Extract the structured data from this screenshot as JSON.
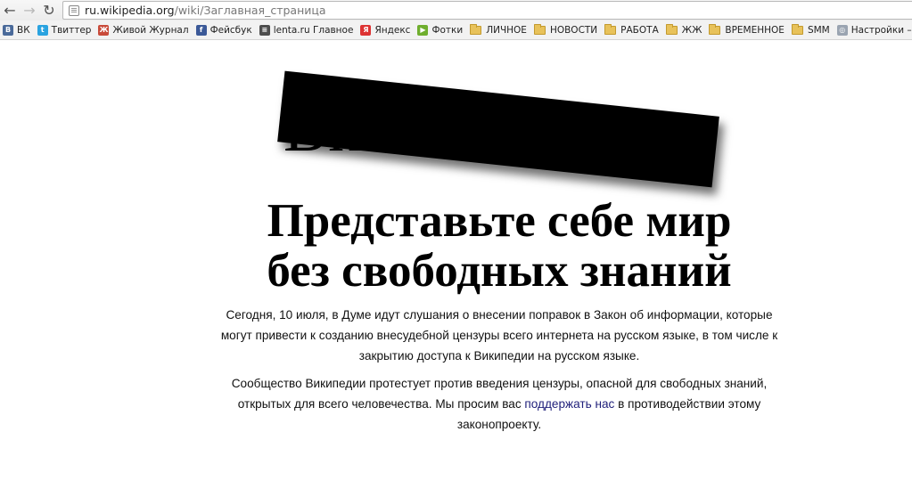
{
  "browser": {
    "nav": {
      "back_glyph": "←",
      "forward_glyph": "→",
      "reload_glyph": "↻"
    },
    "address_bar": {
      "host": "ru.wikipedia.org",
      "path": "/wiki/Заглавная_страница"
    },
    "bookmarks": [
      {
        "label": "ВК",
        "icon": "vk-icon",
        "color": "#4a6a9a",
        "glyph": "В"
      },
      {
        "label": "Твиттер",
        "icon": "twitter-icon",
        "color": "#2aa3e0",
        "glyph": "t"
      },
      {
        "label": "Живой Журнал",
        "icon": "livejournal-icon",
        "color": "#c94b3a",
        "glyph": "Ж"
      },
      {
        "label": "Фейсбук",
        "icon": "facebook-icon",
        "color": "#3b5998",
        "glyph": "f"
      },
      {
        "label": "lenta.ru Главное",
        "icon": "lenta-icon",
        "color": "#4d4d4d",
        "glyph": "≡"
      },
      {
        "label": "Яндекс",
        "icon": "yandex-icon",
        "color": "#d33",
        "glyph": "Я"
      },
      {
        "label": "Фотки",
        "icon": "fotki-icon",
        "color": "#6fae2e",
        "glyph": "▶"
      },
      {
        "label": "ЛИЧНОЕ",
        "icon": "folder-icon"
      },
      {
        "label": "НОВОСТИ",
        "icon": "folder-icon"
      },
      {
        "label": "РАБОТА",
        "icon": "folder-icon"
      },
      {
        "label": "ЖЖ",
        "icon": "folder-icon"
      },
      {
        "label": "ВРЕМЕННОЕ",
        "icon": "folder-icon"
      },
      {
        "label": "SMM",
        "icon": "folder-icon"
      },
      {
        "label": "Настройки – Основ...",
        "icon": "settings-page-icon",
        "color": "#9aa4b1",
        "glyph": "◎"
      }
    ]
  },
  "page": {
    "logo_visible_text": "Вики          я",
    "headline_line1": "Представьте себе мир",
    "headline_line2": "без свободных знаний",
    "paragraph1_line1": "Сегодня, 10 июля, в Думе идут слушания о внесении поправок в Закон об информации, которые",
    "paragraph1_line2": "могут привести к созданию внесудебной цензуры всего интернета на русском языке, в том числе к",
    "paragraph1_line3": "закрытию доступа к Википедии на русском языке.",
    "paragraph2_line1": "Сообщество Википедии протестует против введения цензуры, опасной для свободных знаний,",
    "paragraph2_before_link": "открытых для всего человечества. Мы просим вас ",
    "paragraph2_link": "поддержать нас",
    "paragraph2_after_link": " в противодействии этому",
    "paragraph2_line3": "законопроекту."
  }
}
